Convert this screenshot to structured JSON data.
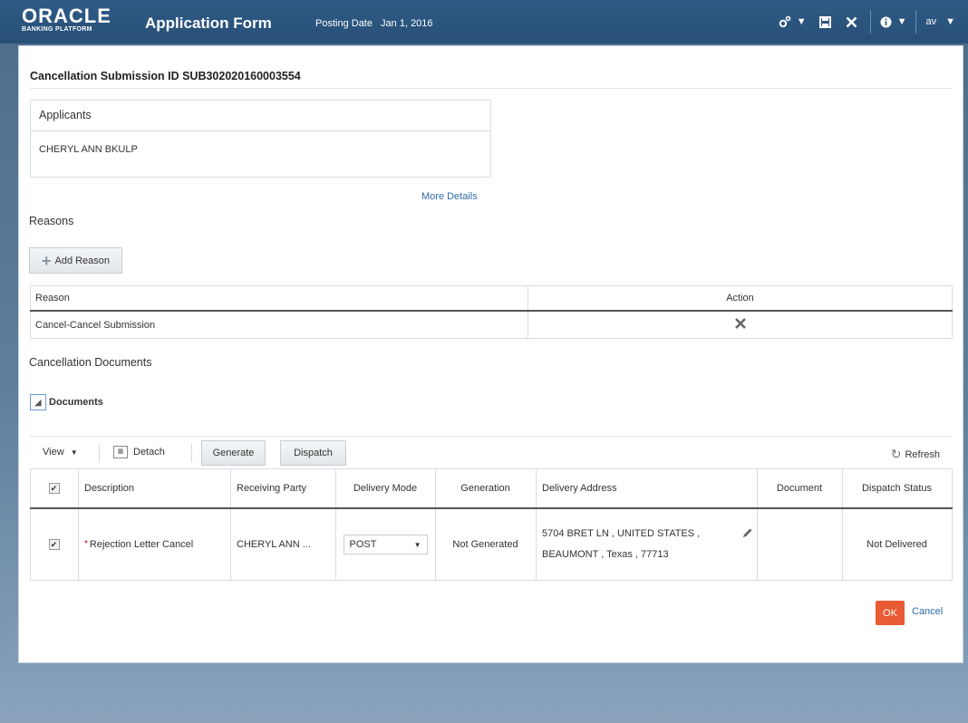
{
  "header": {
    "logo_main": "ORACLE",
    "logo_sub": "BANKING PLATFORM",
    "app_title": "Application Form",
    "posting_label": "Posting Date",
    "posting_value": "Jan 1, 2016",
    "user_initials": "av"
  },
  "dialog": {
    "submission_title": "Cancellation Submission ID SUB302020160003554",
    "applicants_header": "Applicants",
    "applicant_name": "CHERYL ANN BKULP",
    "more_details": "More Details",
    "reasons_title": "Reasons",
    "add_reason": "Add Reason",
    "reasons_table": {
      "columns": [
        "Reason",
        "Action"
      ],
      "rows": [
        {
          "reason": "Cancel-Cancel Submission"
        }
      ]
    },
    "cancellation_documents_title": "Cancellation Documents",
    "documents_toggle": "Documents",
    "toolbar": {
      "view": "View",
      "detach": "Detach",
      "generate": "Generate",
      "dispatch": "Dispatch",
      "refresh": "Refresh"
    },
    "documents_table": {
      "columns": [
        "Description",
        "Receiving Party",
        "Delivery Mode",
        "Generation",
        "Delivery Address",
        "Document",
        "Dispatch Status"
      ],
      "rows": [
        {
          "description": "Rejection Letter Cancel",
          "receiving_party": "CHERYL ANN ...",
          "delivery_mode": "POST",
          "generation": "Not Generated",
          "address_line1": "5704 BRET LN , UNITED STATES ,",
          "address_line2": "BEAUMONT , Texas , 77713",
          "document": "",
          "dispatch_status": "Not Delivered"
        }
      ]
    },
    "ok": "OK",
    "cancel": "Cancel"
  },
  "colors": {
    "header_bg": "#2f5b86",
    "ok_button": "#e85b34",
    "link": "#2e6aa8"
  }
}
